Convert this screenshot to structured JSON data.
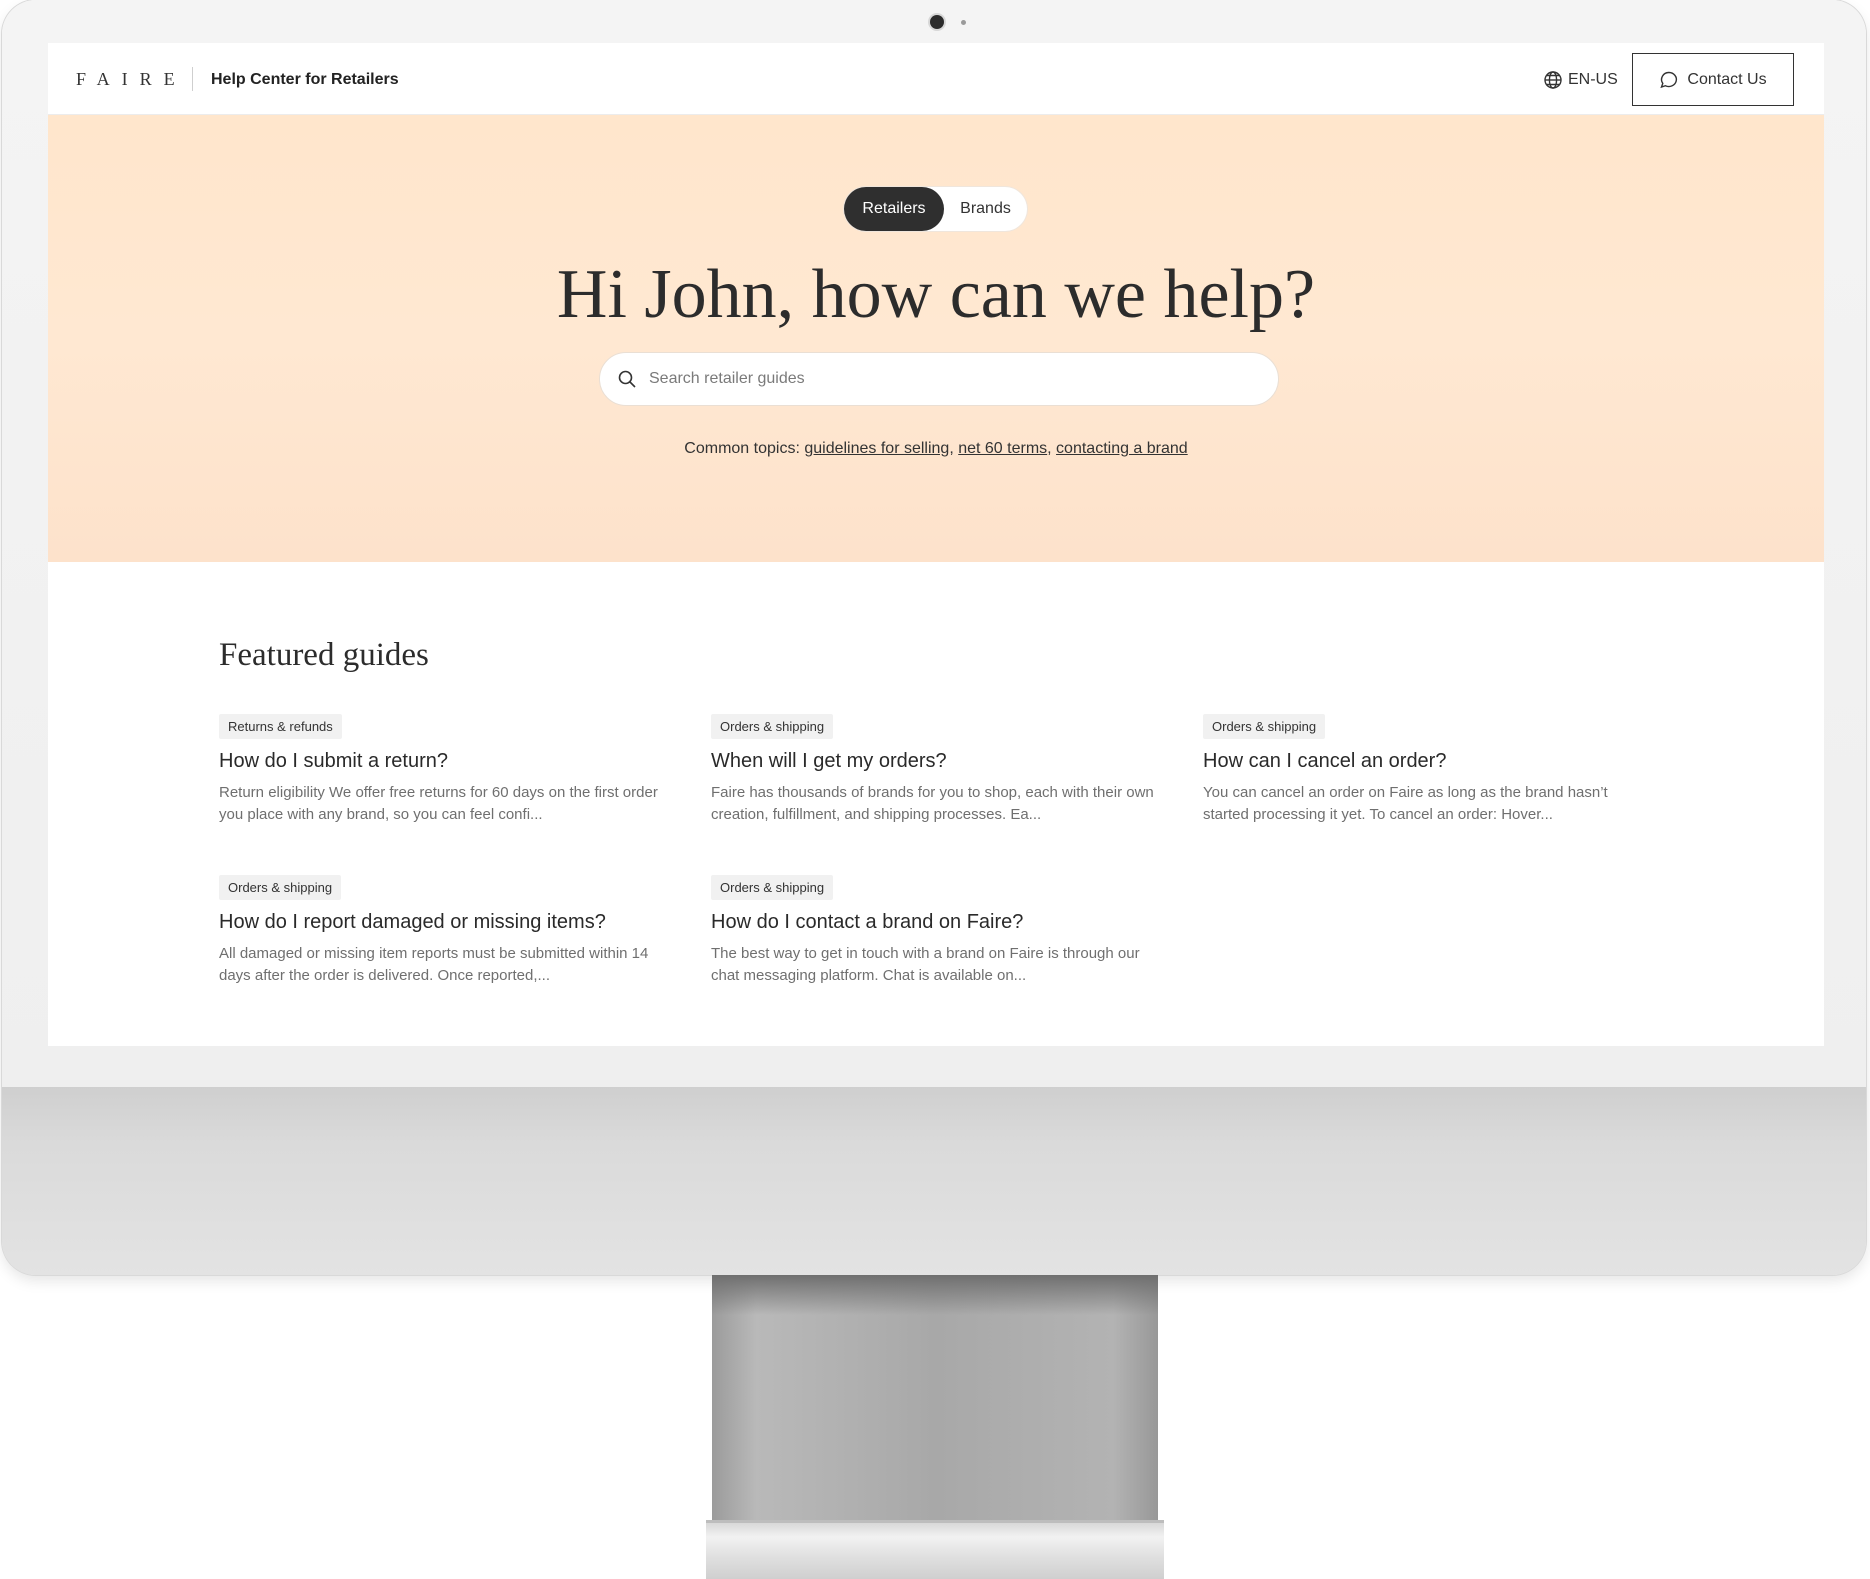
{
  "header": {
    "logo": "FAIRE",
    "title": "Help Center for Retailers",
    "language": "EN-US",
    "contact_label": "Contact Us"
  },
  "hero": {
    "segments": [
      "Retailers",
      "Brands"
    ],
    "active_segment": "Retailers",
    "greeting": "Hi John, how can we help?",
    "search_placeholder": "Search retailer guides",
    "common_topics_label": "Common topics:",
    "topics": [
      "guidelines for selling",
      "net 60 terms",
      "contacting a brand"
    ]
  },
  "featured": {
    "title": "Featured guides",
    "guides": [
      {
        "tag": "Returns & refunds",
        "title": "How do I submit a return?",
        "desc": "Return eligibility We offer free returns for 60 days on the first order you place with any brand, so you can feel confi..."
      },
      {
        "tag": "Orders & shipping",
        "title": "When will I get my orders?",
        "desc": "Faire has thousands of brands for you to shop, each with their own creation, fulfillment, and shipping processes. Ea..."
      },
      {
        "tag": "Orders & shipping",
        "title": "How can I cancel an order?",
        "desc": "You can cancel an order on Faire as long as the brand hasn’t started processing it yet. To cancel an order: Hover..."
      },
      {
        "tag": "Orders & shipping",
        "title": "How do I report damaged or missing items?",
        "desc": "All damaged or missing item reports must be submitted within 14 days after the order is delivered. Once reported,..."
      },
      {
        "tag": "Orders & shipping",
        "title": "How do I contact a brand on Faire?",
        "desc": "The best way to get in touch with a brand on Faire is through our chat messaging platform. Chat is available on..."
      }
    ]
  },
  "colors": {
    "hero_bg": "#ffe6cc",
    "active_segment_bg": "#2f2f2f",
    "text_primary": "#2c2c2c",
    "text_secondary": "#6f6f6f",
    "tag_bg": "#f1f1f1"
  },
  "icons": {
    "language": "globe-icon",
    "contact": "chat-bubble-icon",
    "search": "search-icon"
  }
}
